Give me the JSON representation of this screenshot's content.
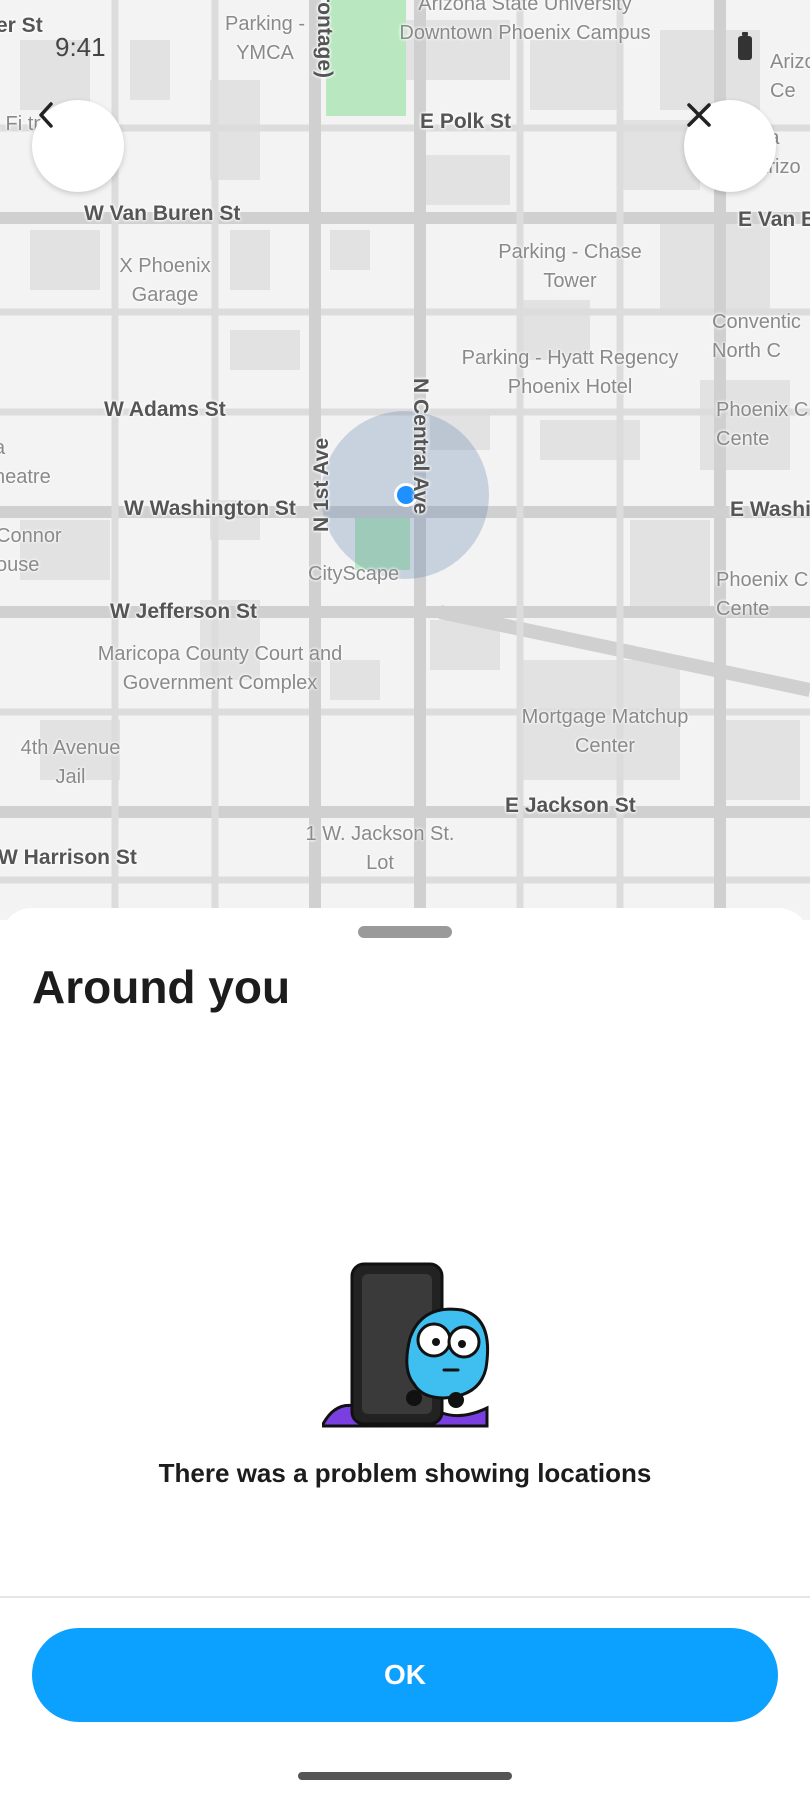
{
  "status_bar": {
    "time": "9:41"
  },
  "map": {
    "streets": [
      "W Van Buren St",
      "E Van B",
      "E Polk St",
      "W Adams St",
      "W Washington St",
      "E Washi",
      "W Jefferson St",
      "E Jackson St",
      "W Harrison St",
      "N 1st Ave",
      "N Central Ave",
      "rontage)",
      "er St"
    ],
    "places": [
      "Parking - YMCA",
      "Arizona State University Downtown Phoenix Campus",
      "X Phoenix Garage",
      "Parking - Chase Tower",
      "Parking - Hyatt Regency Phoenix Hotel",
      "CityScape",
      "Maricopa County Court and Government Complex",
      "Mortgage Matchup Center",
      "4th Avenue Jail",
      "1 W. Jackson St. Lot",
      "x Fi tment - S",
      "a heatre",
      "Connor ouse",
      "Arizo Ce",
      "Pa Arizo",
      "Conventic North C",
      "Phoenix C Cente",
      "Phoenix C Cente"
    ]
  },
  "sheet": {
    "title": "Around you",
    "message": "There was a problem showing locations",
    "ok_label": "OK"
  },
  "icons": [
    "back-arrow-icon",
    "close-icon",
    "location-dot-icon",
    "error-illustration"
  ],
  "colors": {
    "accent": "#0ca0ff",
    "location": "#1e90ff",
    "park": "#b9e8c0"
  }
}
